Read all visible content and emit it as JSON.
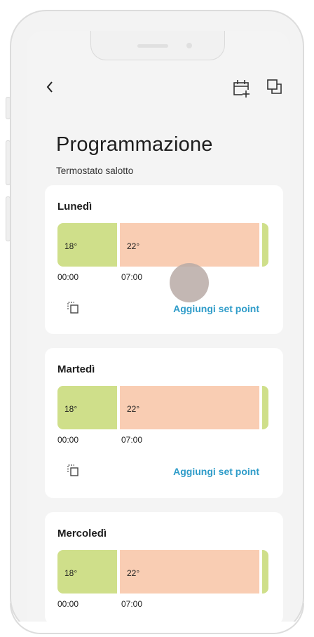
{
  "header": {
    "back_icon": "chevron-left-icon",
    "calendar_icon": "calendar-add-icon",
    "copy_icon": "copy-all-icon"
  },
  "page": {
    "title": "Programmazione",
    "subtitle": "Termostato salotto"
  },
  "days": [
    {
      "name": "Lunedì",
      "segments": [
        {
          "temp": "18°",
          "start": "00:00",
          "color": "#cfdf8a"
        },
        {
          "temp": "22°",
          "start": "07:00",
          "color": "#f9cdb3"
        }
      ],
      "add_label": "Aggiungi set point"
    },
    {
      "name": "Martedì",
      "segments": [
        {
          "temp": "18°",
          "start": "00:00",
          "color": "#cfdf8a"
        },
        {
          "temp": "22°",
          "start": "07:00",
          "color": "#f9cdb3"
        }
      ],
      "add_label": "Aggiungi set point"
    },
    {
      "name": "Mercoledì",
      "segments": [
        {
          "temp": "18°",
          "start": "00:00",
          "color": "#cfdf8a"
        },
        {
          "temp": "22°",
          "start": "07:00",
          "color": "#f9cdb3"
        }
      ]
    }
  ],
  "colors": {
    "accent": "#2f9cc9",
    "cold": "#cfdf8a",
    "warm": "#f9cdb3"
  }
}
